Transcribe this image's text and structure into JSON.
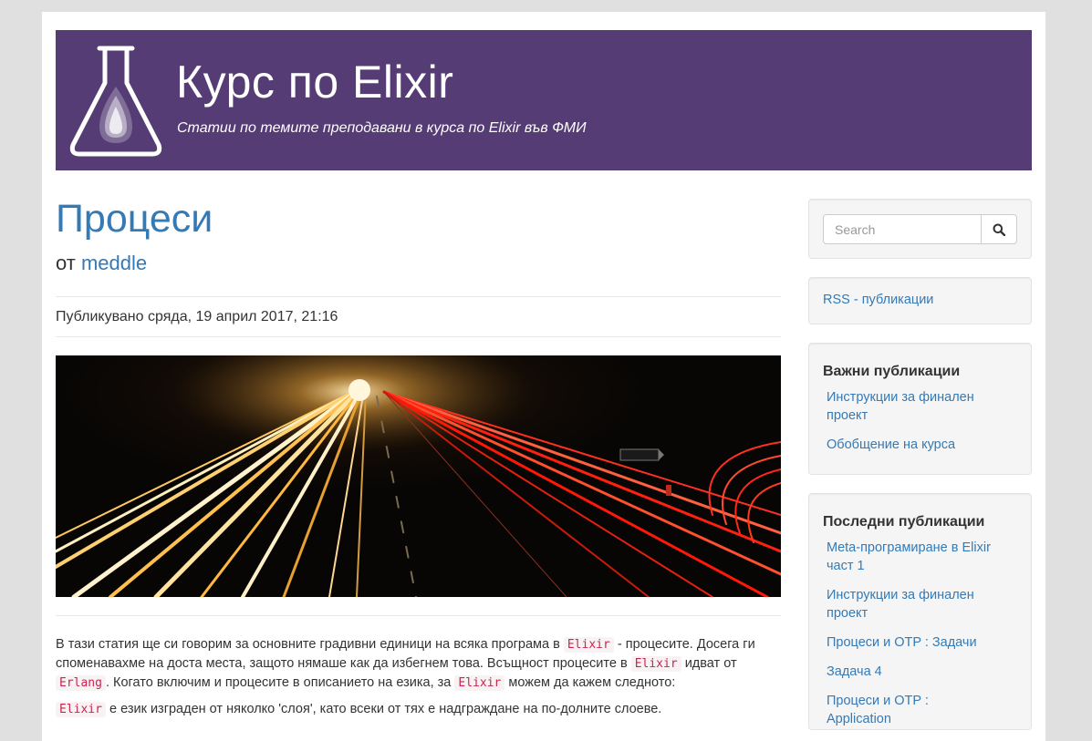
{
  "colors": {
    "header_bg": "#553c75",
    "link": "#337ab7",
    "code_text": "#c7254e",
    "code_bg": "#f9f2f4",
    "page_bg": "#e0e0e0"
  },
  "header": {
    "logo_icon": "flask-drop-icon",
    "title": "Курс по Elixir",
    "subtitle": "Статии по темите преподавани в курса по Elixir във ФМИ"
  },
  "post": {
    "title": "Процеси",
    "by_prefix": "от",
    "author": "meddle",
    "published": "Публикувано сряда, 19 април 2017, 21:16",
    "hero_image": "highway-light-trails-photo",
    "p1": {
      "t1": "В тази статия ще си говорим за основните градивни единици на всяка програма в",
      "c1": "Elixir",
      "t2": "- процесите. Досега ги споменавахме на доста места, защото нямаше как да избегнем това. Всъщност процесите в",
      "c2": "Elixir",
      "t3": "идват от",
      "c3": "Erlang",
      "t4": ". Когато включим и процесите в описанието на езика, за",
      "c4": "Elixir",
      "t5": "можем да кажем следното:"
    },
    "p2": {
      "c1": "Elixir",
      "t1": "е език изграден от няколко 'слоя', като всеки от тях е надграждане на по-долните слоеве."
    }
  },
  "sidebar": {
    "search": {
      "placeholder": "Search",
      "icon": "search-icon"
    },
    "rss_label": "RSS - публикации",
    "important": {
      "heading": "Важни публикации",
      "items": [
        {
          "label": "Инструкции за финален проект"
        },
        {
          "label": "Обобщение на курса"
        }
      ]
    },
    "recent": {
      "heading": "Последни публикации",
      "items": [
        {
          "label": "Meta-програмиране в Elixir част 1"
        },
        {
          "label": "Инструкции за финален проект"
        },
        {
          "label": "Процеси и OTP : Задачи"
        },
        {
          "label": "Задача 4"
        },
        {
          "label": "Процеси и OTP : Application"
        }
      ]
    }
  }
}
